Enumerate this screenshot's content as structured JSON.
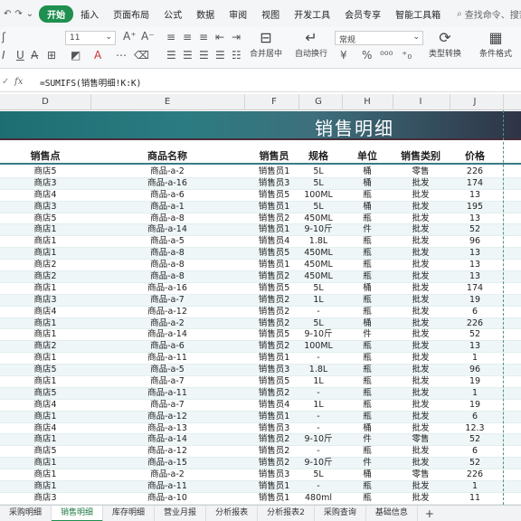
{
  "menu": {
    "tabs": [
      "开始",
      "插入",
      "页面布局",
      "公式",
      "数据",
      "审阅",
      "视图",
      "开发工具",
      "会员专享",
      "智能工具箱"
    ],
    "active_tab": "开始",
    "search_placeholder": "查找命令、搜索模"
  },
  "ribbon": {
    "font_size": "11",
    "number_format": "常规",
    "merge_center": "合并居中",
    "auto_wrap": "自动换行",
    "type_convert": "类型转换",
    "conditional_format": "条件格式"
  },
  "formula_bar": {
    "fx": "fx",
    "formula": "=SUMIFS(销售明细!K:K)"
  },
  "column_headers": [
    "D",
    "E",
    "F",
    "G",
    "H",
    "I",
    "J"
  ],
  "title": "销售明细",
  "table": {
    "headers": [
      "销售点",
      "商品名称",
      "销售员",
      "规格",
      "单位",
      "销售类别",
      "价格"
    ],
    "rows": [
      [
        "商店5",
        "商品-a-2",
        "销售员1",
        "5L",
        "桶",
        "零售",
        "226"
      ],
      [
        "商店3",
        "商品-a-16",
        "销售员3",
        "5L",
        "桶",
        "批发",
        "174"
      ],
      [
        "商店4",
        "商品-a-6",
        "销售员5",
        "100ML",
        "瓶",
        "批发",
        "13"
      ],
      [
        "商店3",
        "商品-a-1",
        "销售员1",
        "5L",
        "桶",
        "批发",
        "195"
      ],
      [
        "商店5",
        "商品-a-8",
        "销售员2",
        "450ML",
        "瓶",
        "批发",
        "13"
      ],
      [
        "商店1",
        "商品-a-14",
        "销售员1",
        "9-10斤",
        "件",
        "批发",
        "52"
      ],
      [
        "商店1",
        "商品-a-5",
        "销售员4",
        "1.8L",
        "瓶",
        "批发",
        "96"
      ],
      [
        "商店1",
        "商品-a-8",
        "销售员5",
        "450ML",
        "瓶",
        "批发",
        "13"
      ],
      [
        "商店2",
        "商品-a-8",
        "销售员1",
        "450ML",
        "瓶",
        "批发",
        "13"
      ],
      [
        "商店2",
        "商品-a-8",
        "销售员2",
        "450ML",
        "瓶",
        "批发",
        "13"
      ],
      [
        "商店1",
        "商品-a-16",
        "销售员5",
        "5L",
        "桶",
        "批发",
        "174"
      ],
      [
        "商店3",
        "商品-a-7",
        "销售员2",
        "1L",
        "瓶",
        "批发",
        "19"
      ],
      [
        "商店4",
        "商品-a-12",
        "销售员2",
        "-",
        "瓶",
        "批发",
        "6"
      ],
      [
        "商店1",
        "商品-a-2",
        "销售员2",
        "5L",
        "桶",
        "批发",
        "226"
      ],
      [
        "商店1",
        "商品-a-14",
        "销售员5",
        "9-10斤",
        "件",
        "批发",
        "52"
      ],
      [
        "商店2",
        "商品-a-6",
        "销售员2",
        "100ML",
        "瓶",
        "批发",
        "13"
      ],
      [
        "商店1",
        "商品-a-11",
        "销售员1",
        "-",
        "瓶",
        "批发",
        "1"
      ],
      [
        "商店5",
        "商品-a-5",
        "销售员3",
        "1.8L",
        "瓶",
        "批发",
        "96"
      ],
      [
        "商店1",
        "商品-a-7",
        "销售员5",
        "1L",
        "瓶",
        "批发",
        "19"
      ],
      [
        "商店5",
        "商品-a-11",
        "销售员2",
        "-",
        "瓶",
        "批发",
        "1"
      ],
      [
        "商店4",
        "商品-a-7",
        "销售员4",
        "1L",
        "瓶",
        "批发",
        "19"
      ],
      [
        "商店1",
        "商品-a-12",
        "销售员1",
        "-",
        "瓶",
        "批发",
        "6"
      ],
      [
        "商店4",
        "商品-a-13",
        "销售员3",
        "-",
        "桶",
        "批发",
        "12.3"
      ],
      [
        "商店1",
        "商品-a-14",
        "销售员2",
        "9-10斤",
        "件",
        "零售",
        "52"
      ],
      [
        "商店5",
        "商品-a-12",
        "销售员2",
        "-",
        "瓶",
        "批发",
        "6"
      ],
      [
        "商店1",
        "商品-a-15",
        "销售员2",
        "9-10斤",
        "件",
        "批发",
        "52"
      ],
      [
        "商店1",
        "商品-a-2",
        "销售员3",
        "5L",
        "桶",
        "零售",
        "226"
      ],
      [
        "商店1",
        "商品-a-11",
        "销售员1",
        "-",
        "瓶",
        "批发",
        "1"
      ],
      [
        "商店3",
        "商品-a-10",
        "销售员1",
        "480ml",
        "瓶",
        "批发",
        "11"
      ]
    ]
  },
  "sheets": [
    "采购明细",
    "销售明细",
    "库存明细",
    "营业月报",
    "分析报表",
    "分析报表2",
    "采购查询",
    "基础信息"
  ],
  "active_sheet": "销售明细",
  "colors": {
    "accent": "#1f8f4f",
    "title_band": "#2b7c82",
    "stripe": "#eef6f7"
  }
}
